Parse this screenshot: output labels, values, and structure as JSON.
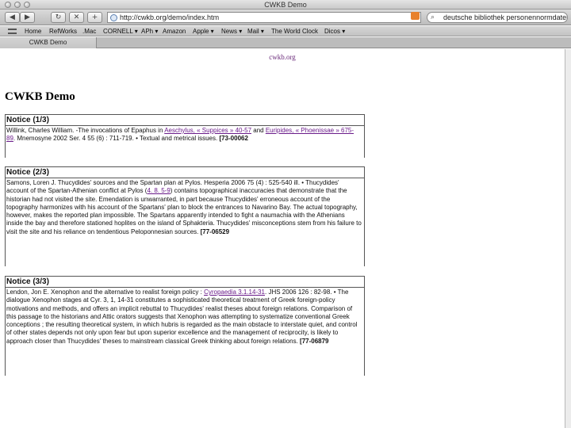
{
  "window": {
    "title": "CWKB Demo"
  },
  "toolbar": {
    "back_glyph": "◀",
    "forward_glyph": "▶",
    "reload_glyph": "↻",
    "stop_glyph": "✕",
    "add_glyph": "+",
    "url": "http://cwkb.org/demo/index.htm",
    "search_glyph": "⌕",
    "search_text": "deutsche bibliothek personennormdaten"
  },
  "bookmarks": {
    "items": [
      "Home",
      "RefWorks",
      ".Mac",
      "CORNELL ▾",
      "APh ▾",
      "Amazon",
      "Apple ▾",
      "News ▾",
      "Mail ▾",
      "The World Clock",
      "Dicos ▾"
    ]
  },
  "tabs": [
    {
      "label": "CWKB Demo"
    }
  ],
  "page": {
    "site_link": "cwkb.org",
    "title": "CWKB Demo",
    "notices": [
      {
        "heading": "Notice (1/3)",
        "parts": [
          {
            "t": "Willink, Charles William. -The invocations of Epaphus in "
          },
          {
            "a": "Aeschylus, « Suppices » 40-57"
          },
          {
            "t": " and "
          },
          {
            "a": "Euripides, « Phoenissae » 675-89"
          },
          {
            "t": ". Mnemosyne 2002 Ser. 4 55 (6) : 711-719. • Textual and metrical issues. "
          },
          {
            "b": "[73-00062"
          }
        ]
      },
      {
        "heading": "Notice (2/3)",
        "parts": [
          {
            "t": "Samons, Loren J. Thucydides' sources and the Spartan plan at Pylos. Hesperia 2006 75 (4) : 525-540 ill. • Thucydides' account of the Spartan-Athenian conflict at Pylos ("
          },
          {
            "a": "4. 8. 5-9"
          },
          {
            "t": ") contains topographical inaccuracies that demonstrate that the historian had not visited the site. Emendation is unwarranted, in part because Thucydides' erroneous account of the topography harmonizes with his account of the Spartans' plan to block the entrances to Navarino Bay. The actual topography, however, makes the reported plan impossible. The Spartans apparently intended to fight a naumachia with the Athenians inside the bay and therefore stationed hoplites on the island of Sphakteria. Thucydides' misconceptions stem from his failure to visit the site and his reliance on tendentious Peloponnesian sources. "
          },
          {
            "b": "[77-06529"
          }
        ]
      },
      {
        "heading": "Notice (3/3)",
        "parts": [
          {
            "t": "Lendon, Jon E. Xenophon and the alternative to realist foreign policy : "
          },
          {
            "a": "Cyropaedia 3.1.14-31"
          },
          {
            "t": ". JHS 2006 126 : 82-98. • The dialogue Xenophon stages at Cyr. 3, 1, 14-31 constitutes a sophisticated theoretical treatment of Greek foreign-policy motivations and methods, and offers an implicit rebuttal to Thucydides' realist theses about foreign relations. Comparison of this passage to the historians and Attic orators suggests that Xenophon was attempting to systematize conventional Greek conceptions ; the resulting theoretical system, in which hubris is regarded as the main obstacle to interstate quiet, and control of other states depends not only upon fear but upon superior excellence and the management of reciprocity, is likely to approach closer than Thucydides' theses to mainstream classical Greek thinking about foreign relations. "
          },
          {
            "b": "[77-06879"
          }
        ]
      }
    ]
  }
}
